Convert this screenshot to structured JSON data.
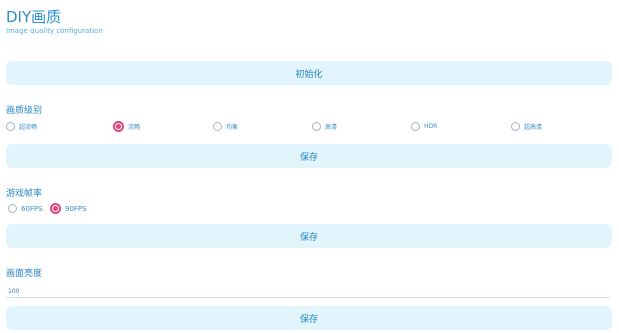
{
  "header": {
    "title": "DIY画质",
    "subtitle": "Image quality configuration"
  },
  "init_button": {
    "label": "初始化"
  },
  "quality": {
    "label": "画质级别",
    "options": [
      "超流畅",
      "流畅",
      "均衡",
      "高清",
      "HDR",
      "超高清"
    ],
    "selected": "流畅",
    "save_label": "保存"
  },
  "fps": {
    "label": "游戏帧率",
    "options": [
      "60FPS",
      "90FPS"
    ],
    "selected": "90FPS",
    "save_label": "保存"
  },
  "brightness": {
    "label": "画面亮度",
    "value": "100",
    "save_label": "保存"
  },
  "colors": {
    "accent": "#e0457b",
    "primary_text": "#2a8fd0",
    "button_bg": "#e2f4fc"
  }
}
